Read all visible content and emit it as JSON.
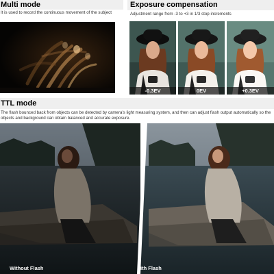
{
  "multi_mode": {
    "title": "Multi mode",
    "description": "It is used to record the continuous movement of the subject"
  },
  "exposure": {
    "title": "Exposure compensation",
    "description": "Adjustment range from -3 to +3 in 1/3 stop increments",
    "labels": [
      "-0.3EV",
      "0EV",
      "+0.3EV"
    ]
  },
  "ttl": {
    "title": "TTL mode",
    "description": "The flash bounced back from objects can be detected by camera's light measuring system, and then can adjust flash  output automatically so the objects and background can obtain balanced and accurate exposure.",
    "left_caption": "Without Flash",
    "right_caption": "With Flash"
  },
  "colors": {
    "heading_bg": "#efefef",
    "label_bg": "#1a1a1a"
  }
}
